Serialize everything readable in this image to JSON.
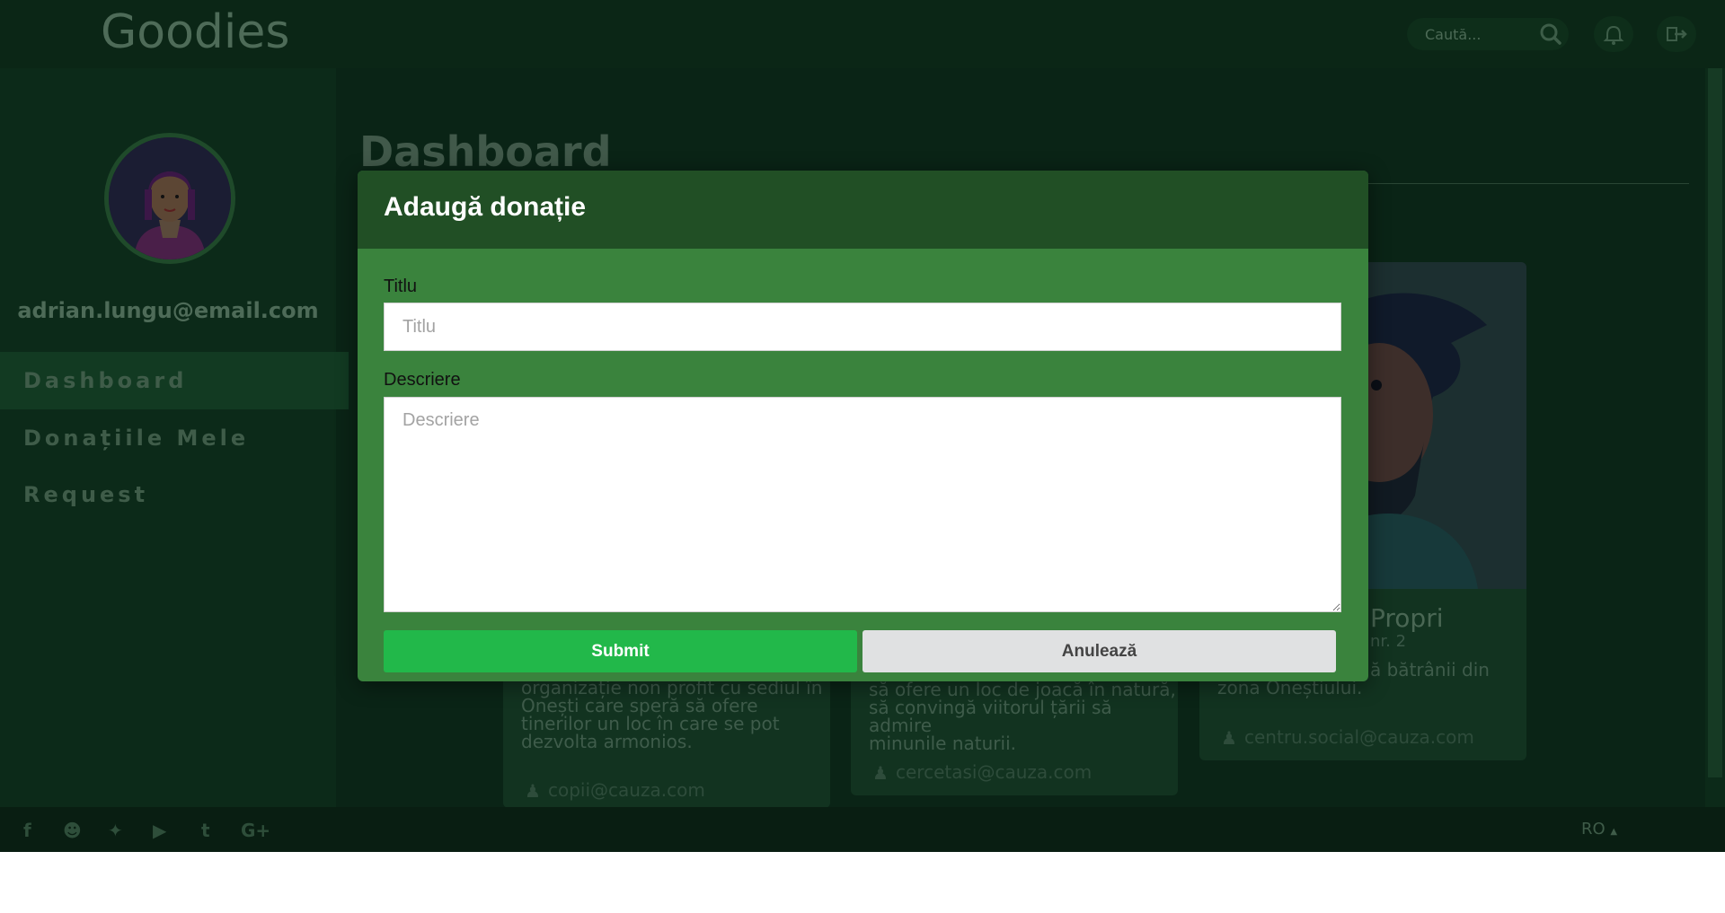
{
  "app": {
    "name": "Goodies"
  },
  "header": {
    "search_placeholder": "Caută...",
    "icons": [
      "search-icon",
      "bell-icon",
      "logout-icon"
    ]
  },
  "sidebar": {
    "user_email": "adrian.lungu@email.com",
    "items": [
      {
        "label": "Dashboard",
        "active": true
      },
      {
        "label": "Donațiile Mele",
        "active": false
      },
      {
        "label": "Request",
        "active": false
      }
    ]
  },
  "main": {
    "title": "Dashboard",
    "cards": [
      {
        "description_lines": [
          "organizație non profit cu sediul în",
          "Onești care speră să ofere",
          "tinerilor un loc în care se pot",
          "dezvolta armonios."
        ],
        "email": "copii@cauza.com"
      },
      {
        "description_lines": [
          "să ofere un loc de joacă în natură,",
          "să convingă viitorul țării să admire",
          "minunile naturii."
        ],
        "email": "cercetasi@cauza.com"
      },
      {
        "title_fragment": "Propri",
        "subtitle_fragment": "nr. 2",
        "description_lines": [
          "ă bătrânii din",
          "zona Oneștiului."
        ],
        "email": "centru.social@cauza.com"
      }
    ]
  },
  "footer": {
    "social_icons": [
      "facebook-icon",
      "github-icon",
      "twitter-icon",
      "youtube-icon",
      "tumblr-icon",
      "google-plus-icon"
    ],
    "language": "RO"
  },
  "modal": {
    "title": "Adaugă donație",
    "fields": {
      "title_label": "Titlu",
      "title_placeholder": "Titlu",
      "title_value": "",
      "description_label": "Descriere",
      "description_placeholder": "Descriere",
      "description_value": ""
    },
    "buttons": {
      "submit": "Submit",
      "cancel": "Anulează"
    }
  },
  "colors": {
    "modal_header": "#214f25",
    "modal_body": "#3a833d",
    "submit_button": "#22b84a",
    "cancel_button": "#e0e1e2",
    "background_dim": "#0a2416"
  }
}
